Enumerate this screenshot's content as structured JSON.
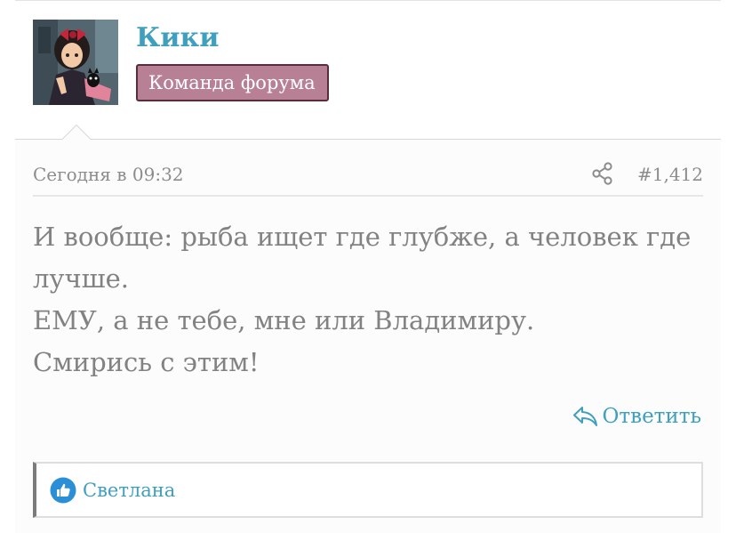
{
  "user": {
    "name": "Кики",
    "title": "Команда форума",
    "avatar_icon": "avatar-image"
  },
  "post": {
    "date": "Сегодня в 09:32",
    "number": "#1,412",
    "share_icon": "share-icon",
    "lines": [
      "И вообще: рыба ищет где глубже, а человек где",
      "лучше.",
      "ЕМУ, а не тебе, мне или Владимиру.",
      "Смирись с этим!"
    ]
  },
  "actions": {
    "reply_label": "Ответить",
    "reply_icon": "reply-icon"
  },
  "reactions": {
    "icon": "like-icon",
    "users": "Светлана"
  },
  "colors": {
    "accent": "#3f9fbf",
    "title_badge": "#b78094",
    "text": "#828282",
    "meta": "#8c8c8c"
  }
}
